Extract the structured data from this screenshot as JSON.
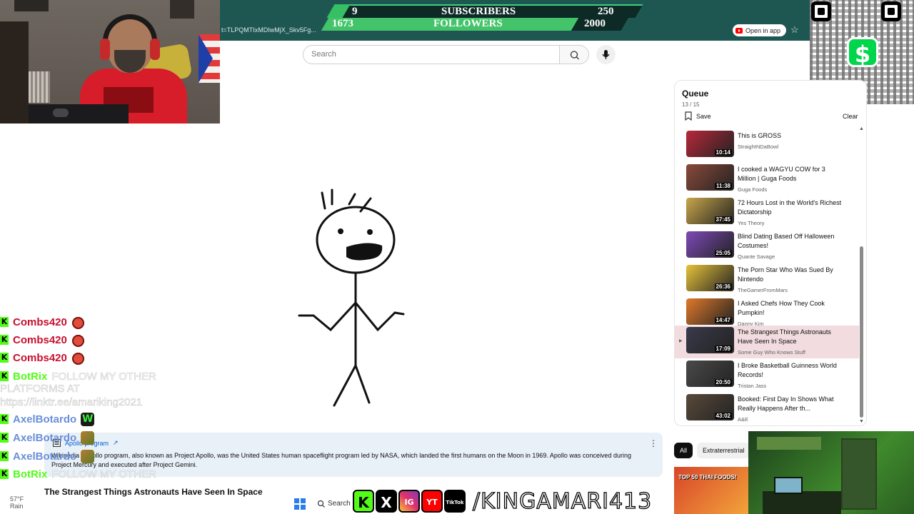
{
  "goal": {
    "subscribers": {
      "current": "9",
      "label": "SUBSCRIBERS",
      "target": "250"
    },
    "followers": {
      "current": "1673",
      "label": "FOLLOWERS",
      "target": "2000"
    }
  },
  "browser": {
    "url_fragment": "t=TLPQMTIxMDIwMjX_Skv5Fg...",
    "open_in_app": "Open in app"
  },
  "search": {
    "placeholder": "Search"
  },
  "queue": {
    "title": "Queue",
    "count": "13 / 15",
    "save_label": "Save",
    "clear_label": "Clear",
    "items": [
      {
        "title": "This is GROSS",
        "channel": "StraightNDaBowl",
        "duration": "10:14",
        "color": "#b8283a"
      },
      {
        "title": "I cooked a WAGYU COW for 3 Million | Guga Foods",
        "channel": "Guga Foods",
        "duration": "11:38",
        "color": "#8a4a3a"
      },
      {
        "title": "72 Hours Lost in the World's Richest Dictatorship",
        "channel": "Yes Theory",
        "duration": "37:45",
        "color": "#c9a64a"
      },
      {
        "title": "Blind Dating Based Off Halloween Costumes!",
        "channel": "Quante Savage",
        "duration": "25:05",
        "color": "#7e4ab8"
      },
      {
        "title": "The Porn Star Who Was Sued By Nintendo",
        "channel": "TheGamerFromMars",
        "duration": "26:36",
        "color": "#e7c23a"
      },
      {
        "title": "I Asked Chefs How They Cook Pumpkin!",
        "channel": "Danny Kim",
        "duration": "14:47",
        "color": "#e07a2a"
      },
      {
        "title": "The Strangest Things Astronauts Have Seen In Space",
        "channel": "Some Guy Who Knows Stuff",
        "duration": "17:09",
        "color": "#3a3a4a"
      },
      {
        "title": "I Broke Basketball Guinness World Records!",
        "channel": "Tristan Jass",
        "duration": "20:50",
        "color": "#4a4a4a"
      },
      {
        "title": "Booked: First Day In Shows What Really Happens After th...",
        "channel": "A&E",
        "duration": "43:02",
        "color": "#5a4a3a"
      }
    ]
  },
  "chips": {
    "all": "All",
    "extraterrestrial": "Extraterrestrial"
  },
  "recommendation": {
    "thumb_text": "TOP 50 THAI FOODS!"
  },
  "wiki": {
    "title": "Apollo program",
    "source": "Wikipedia",
    "body": "Apollo program, also known as Project Apollo, was the United States human spaceflight program led by NASA, which landed the first humans on the Moon in 1969. Apollo was conceived during Project Mercury and executed after Project Gemini."
  },
  "video_title": "The Strangest Things Astronauts Have Seen In Space",
  "chat": [
    {
      "user": "Combs420",
      "user_color": "#c8102e",
      "emote": "bull"
    },
    {
      "user": "Combs420",
      "user_color": "#c8102e",
      "emote": "bull"
    },
    {
      "user": "Combs420",
      "user_color": "#c8102e",
      "emote": "bull"
    },
    {
      "user": "BotRix",
      "user_color": "#53fc18",
      "message": "FOLLOW MY OTHER"
    },
    {
      "user": "AxelBotardo",
      "user_color": "#6a8fd8",
      "emote": "w"
    },
    {
      "user": "AxelBotardo",
      "user_color": "#6a8fd8",
      "emote": "mixed"
    },
    {
      "user": "AxelBotardo",
      "user_color": "#6a8fd8",
      "emote": "mixed"
    },
    {
      "user": "BotRix",
      "user_color": "#53fc18",
      "message": "FOLLOW MY OTHER"
    }
  ],
  "chat_wrap": {
    "line1": "PLATFORMS AT",
    "line2": "https://linktr.ee/amariking2021"
  },
  "taskbar": {
    "weather_temp": "57°F",
    "weather": "Rain",
    "search": "Search"
  },
  "social": {
    "handle": "/KINGAMARI413",
    "icons": [
      "K",
      "X",
      "IG",
      "YT",
      "TikTok"
    ]
  },
  "colors": {
    "kick_green": "#53fc18",
    "teal_bar": "#1e5752",
    "yt_red": "#ff0000"
  }
}
